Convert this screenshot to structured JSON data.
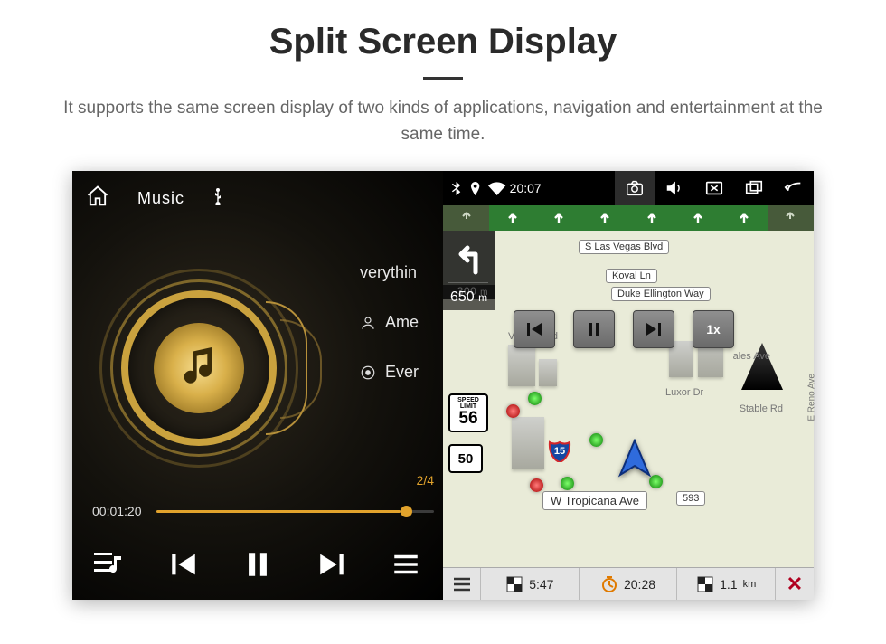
{
  "header": {
    "title": "Split Screen Display",
    "description": "It supports the same screen display of two kinds of applications, navigation and entertainment at the same time."
  },
  "music": {
    "tab_label": "Music",
    "track_title": "verythin",
    "artist": "Ame",
    "album": "Ever",
    "counter": "2/4",
    "play_time": "00:01:20"
  },
  "nav": {
    "clock": "20:07",
    "turn_distance_next": "300",
    "turn_distance_next_unit": "m",
    "turn_distance_total": "650",
    "turn_distance_total_unit": "m",
    "speed_limit_label_1": "SPEED",
    "speed_limit_label_2": "LIMIT",
    "speed_limit_value": "56",
    "route_number": "50",
    "interstate": "15",
    "playback_speed": "1x",
    "streets": {
      "s_las_vegas": "S Las Vegas Blvd",
      "koval": "Koval Ln",
      "duke": "Duke Ellington Way",
      "vegas_blvd": "Vegas Blvd",
      "hacienda": "ales Ave",
      "luxor": "Luxor Dr",
      "stable": "Stable Rd",
      "reno": "E Reno Ave",
      "tropicana": "W Tropicana Ave",
      "exit": "593"
    },
    "bottom": {
      "eta": "5:47",
      "duration": "20:28",
      "distance_value": "1.1",
      "distance_unit": "km"
    }
  }
}
